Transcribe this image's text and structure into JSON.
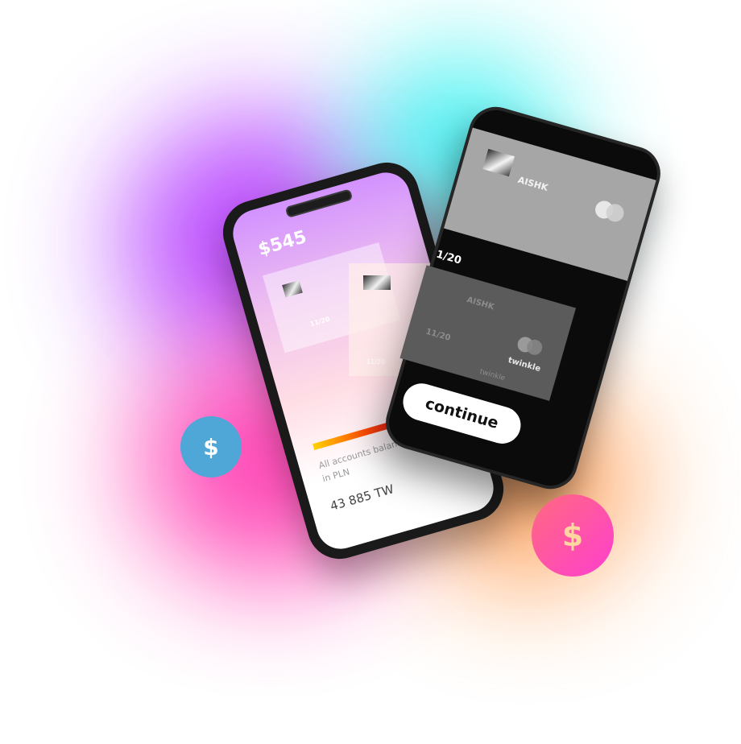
{
  "coins": {
    "left_symbol": "$",
    "right_symbol": "$"
  },
  "phone_left": {
    "balance": "$545",
    "card_expiry": "11/20",
    "accounts_label_line1": "All accounts balance",
    "accounts_label_line2": "in PLN",
    "total": "43 885 TW"
  },
  "floating_card": {
    "expiry": "11/20"
  },
  "phone_right": {
    "card_top_brand": "AISHK",
    "card_index": "1/20",
    "card_bottom_brand": "AISHK",
    "card_bottom_expiry": "11/20",
    "card_bottom_wordmark": "twinkle",
    "card_bottom_signature": "twinkle",
    "continue_label": "continue"
  },
  "colors": {
    "blob_purple": "#b845ff",
    "blob_cyan": "#35f0f0",
    "blob_pink": "#ff3fb3",
    "blob_orange": "#ffa25c",
    "coin_blue": "#4ea7d6",
    "coin_pink": "#ff4fb0"
  }
}
